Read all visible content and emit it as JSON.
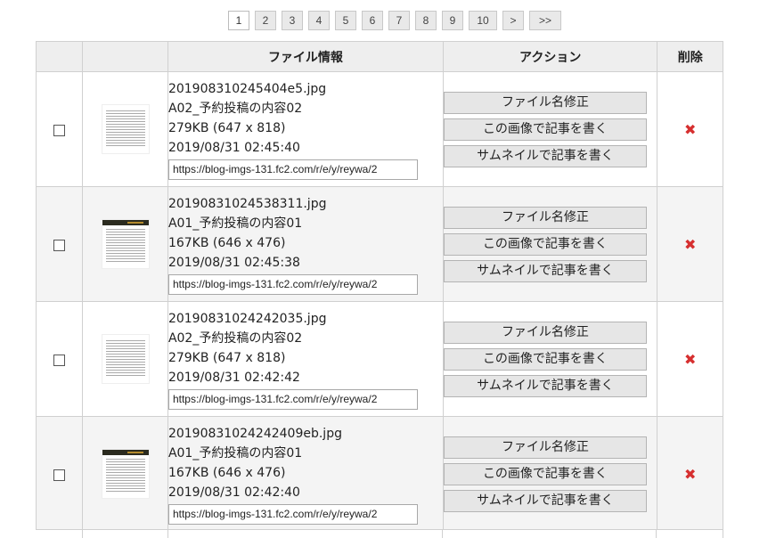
{
  "pagination": {
    "pages": [
      "1",
      "2",
      "3",
      "4",
      "5",
      "6",
      "7",
      "8",
      "9",
      "10"
    ],
    "current": "1",
    "next_label": ">",
    "last_label": ">>"
  },
  "table": {
    "headers": {
      "select": "",
      "thumbnail": "",
      "file_info": "ファイル情報",
      "action": "アクション",
      "delete": "削除"
    },
    "action_labels": {
      "rename": "ファイル名修正",
      "write_with_image": "この画像で記事を書く",
      "write_with_thumbnail": "サムネイルで記事を書く"
    },
    "delete_icon": "x-mark-icon",
    "rows": [
      {
        "filename": "201908310245404e5.jpg",
        "title": "A02_予約投稿の内容02",
        "size": "279KB (647 x 818)",
        "datetime": "2019/08/31 02:45:40",
        "url": "https://blog-imgs-131.fc2.com/r/e/y/reywa/2",
        "thumb_style": "text-page"
      },
      {
        "filename": "20190831024538311.jpg",
        "title": "A01_予約投稿の内容01",
        "size": "167KB (646 x 476)",
        "datetime": "2019/08/31 02:45:38",
        "url": "https://blog-imgs-131.fc2.com/r/e/y/reywa/2",
        "thumb_style": "banner-page"
      },
      {
        "filename": "20190831024242035.jpg",
        "title": "A02_予約投稿の内容02",
        "size": "279KB (647 x 818)",
        "datetime": "2019/08/31 02:42:42",
        "url": "https://blog-imgs-131.fc2.com/r/e/y/reywa/2",
        "thumb_style": "text-page"
      },
      {
        "filename": "20190831024242409eb.jpg",
        "title": "A01_予約投稿の内容01",
        "size": "167KB (646 x 476)",
        "datetime": "2019/08/31 02:42:40",
        "url": "https://blog-imgs-131.fc2.com/r/e/y/reywa/2",
        "thumb_style": "banner-page"
      }
    ]
  },
  "colors": {
    "header_bg": "#eeeeee",
    "border": "#d0d0d0",
    "delete_red": "#d62f2f",
    "button_bg": "#e6e6e6"
  }
}
